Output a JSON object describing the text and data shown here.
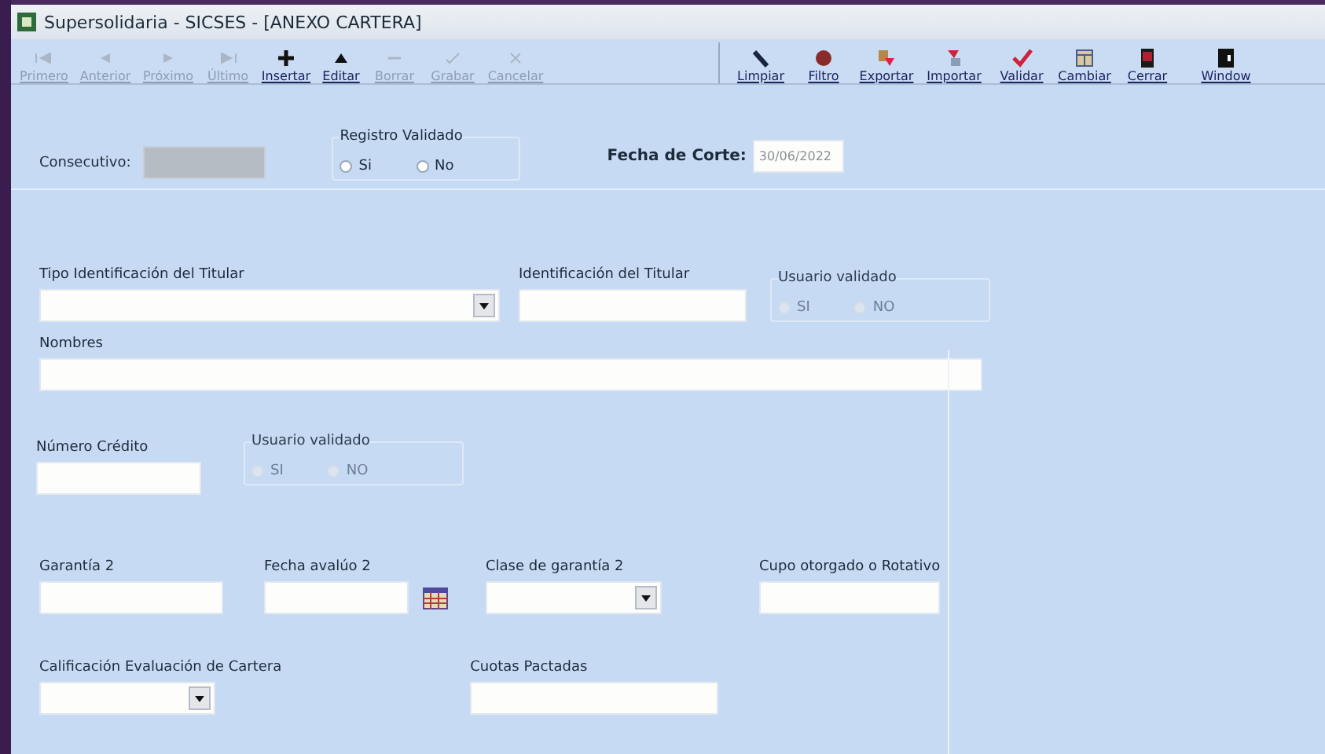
{
  "window": {
    "title": "Supersolidaria - SICSES - [ANEXO CARTERA]"
  },
  "toolbar": [
    {
      "label": "Primero",
      "disabled": true
    },
    {
      "label": "Anterior",
      "disabled": true
    },
    {
      "label": "Próximo",
      "disabled": true
    },
    {
      "label": "Último",
      "disabled": true
    },
    {
      "label": "Insertar",
      "disabled": false
    },
    {
      "label": "Editar",
      "disabled": false
    },
    {
      "label": "Borrar",
      "disabled": true
    },
    {
      "label": "Grabar",
      "disabled": true
    },
    {
      "label": "Cancelar",
      "disabled": true
    },
    {
      "label": "Limpiar",
      "disabled": false
    },
    {
      "label": "Filtro",
      "disabled": false
    },
    {
      "label": "Exportar",
      "disabled": false
    },
    {
      "label": "Importar",
      "disabled": false
    },
    {
      "label": "Validar",
      "disabled": false
    },
    {
      "label": "Cambiar",
      "disabled": false
    },
    {
      "label": "Cerrar",
      "disabled": false
    },
    {
      "label": "Window",
      "disabled": false
    }
  ],
  "header": {
    "consecutivo": {
      "label": "Consecutivo:",
      "disabled": true
    },
    "registro_validado": {
      "label": "Registro Validado",
      "disabled": false,
      "options": [
        {
          "label": "Si",
          "selected": false
        },
        {
          "label": "No",
          "selected": false
        }
      ]
    },
    "fecha_corte": {
      "label": "Fecha de Corte:",
      "value": "30/06/2022"
    }
  },
  "form": {
    "tipo_identificacion": {
      "label": "Tipo Identificación del Titular"
    },
    "identificacion": {
      "label": "Identificación del Titular"
    },
    "usuario_validado_1": {
      "label": "Usuario validado",
      "disabled": true,
      "options": [
        {
          "label": "SI",
          "selected": false
        },
        {
          "label": "NO",
          "selected": false
        }
      ]
    },
    "nombres": {
      "label": "Nombres"
    },
    "numero_credito": {
      "label": "Número Crédito"
    },
    "usuario_validado_2": {
      "label": "Usuario validado",
      "disabled": true,
      "options": [
        {
          "label": "SI",
          "selected": false
        },
        {
          "label": "NO",
          "selected": false
        }
      ]
    },
    "garantia_2": {
      "label": "Garantía 2"
    },
    "fecha_avaluo_2": {
      "label": "Fecha avalúo 2"
    },
    "clase_garantia_2": {
      "label": "Clase de garantía 2"
    },
    "cupo": {
      "label": "Cupo otorgado o Rotativo"
    },
    "calificacion": {
      "label": "Calificación Evaluación de Cartera"
    },
    "cuotas": {
      "label": "Cuotas Pactadas"
    }
  }
}
